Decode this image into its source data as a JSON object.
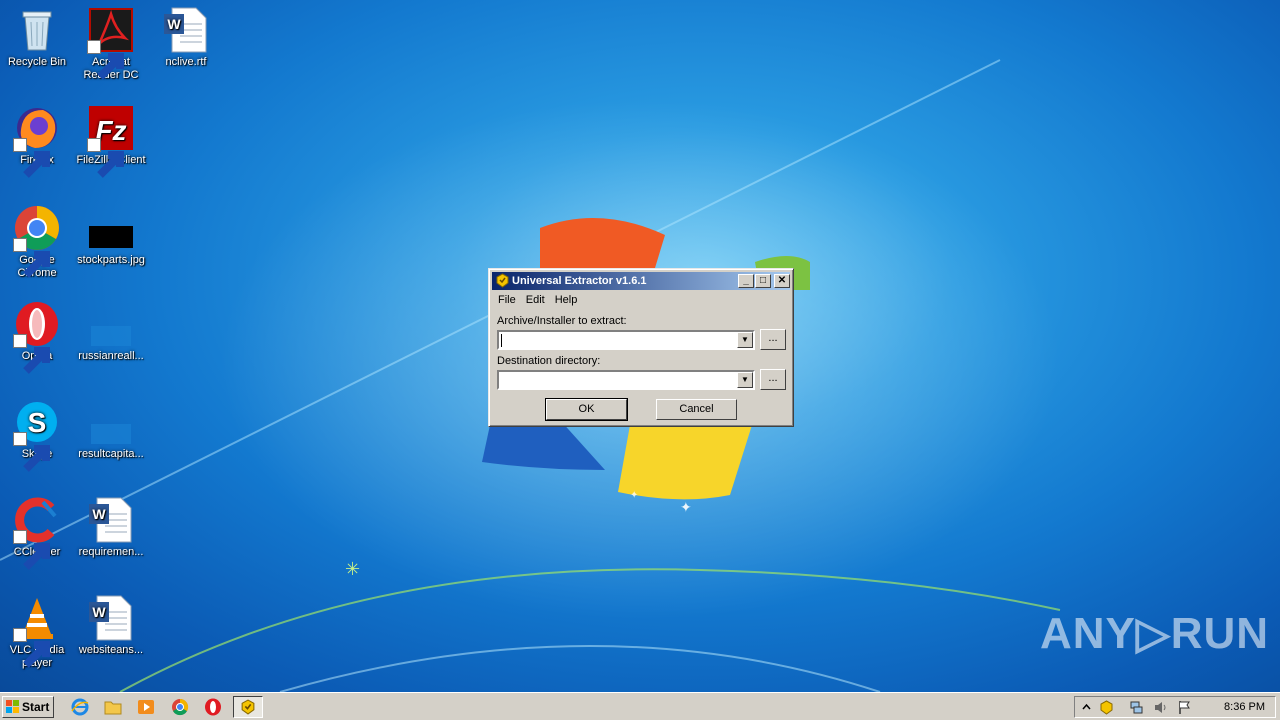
{
  "desktop_icons": [
    {
      "label": "Recycle Bin",
      "icon": "recycle-bin-icon"
    },
    {
      "label": "Acrobat Reader DC",
      "icon": "acrobat-reader-icon"
    },
    {
      "label": "nclive.rtf",
      "icon": "word-document-icon"
    },
    {
      "label": "Firefox",
      "icon": "firefox-icon"
    },
    {
      "label": "FileZilla Client",
      "icon": "filezilla-icon"
    },
    {
      "label": "Google Chrome",
      "icon": "chrome-icon"
    },
    {
      "label": "stockparts.jpg",
      "icon": "image-file-icon"
    },
    {
      "label": "Opera",
      "icon": "opera-icon"
    },
    {
      "label": "russianreall...",
      "icon": "blank-file-icon"
    },
    {
      "label": "Skype",
      "icon": "skype-icon"
    },
    {
      "label": "resultcapita...",
      "icon": "blank-file-icon"
    },
    {
      "label": "CCleaner",
      "icon": "ccleaner-icon"
    },
    {
      "label": "requiremen...",
      "icon": "word-document-icon"
    },
    {
      "label": "VLC media player",
      "icon": "vlc-icon"
    },
    {
      "label": "websiteans...",
      "icon": "word-document-icon"
    }
  ],
  "dialog": {
    "title": "Universal Extractor v1.6.1",
    "menu": [
      "File",
      "Edit",
      "Help"
    ],
    "archive_label": "Archive/Installer to extract:",
    "archive_value": "",
    "destination_label": "Destination directory:",
    "destination_value": "",
    "browse_label": "...",
    "ok_label": "OK",
    "cancel_label": "Cancel",
    "minimize_glyph": "_",
    "maximize_glyph": "□",
    "close_glyph": "✕"
  },
  "watermark": "ANY▷RUN",
  "taskbar": {
    "start_label": "Start",
    "quick_launch": [
      "internet-explorer-icon",
      "folder-icon",
      "media-player-icon",
      "chrome-icon",
      "opera-icon"
    ],
    "active_task_icon": "universal-extractor-icon",
    "tray_icons": [
      "show-hidden-icons-chevron",
      "universal-extractor-tray-icon",
      "network-icon",
      "volume-icon",
      "action-center-flag-icon"
    ],
    "clock": "8:36 PM"
  }
}
